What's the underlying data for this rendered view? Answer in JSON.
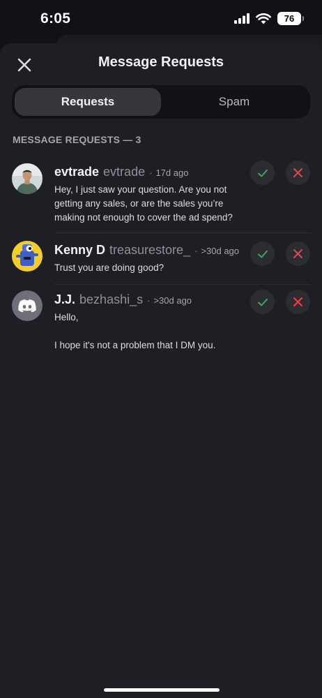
{
  "status_bar": {
    "time": "6:05",
    "battery": "76",
    "icons": [
      "signal-icon",
      "wifi-icon",
      "battery-icon"
    ]
  },
  "header": {
    "title": "Message Requests",
    "close_icon": "close-icon"
  },
  "tabs": [
    {
      "label": "Requests",
      "active": true
    },
    {
      "label": "Spam",
      "active": false
    }
  ],
  "section": {
    "title": "MESSAGE REQUESTS — 3"
  },
  "requests": [
    {
      "display_name": "evtrade",
      "username": "evtrade",
      "separator": "·",
      "timestamp": "17d ago",
      "message": "Hey, I just saw your question. Are you not getting any sales, or are the sales you’re making not enough to cover the ad spend?",
      "avatar": "user-photo-avatar"
    },
    {
      "display_name": "Kenny D",
      "username": "treasurestore_",
      "separator": "·",
      "timestamp": ">30d ago",
      "message": "Trust you are doing good?",
      "avatar": "cartoon-avatar"
    },
    {
      "display_name": "J.J.",
      "username": "bezhashi_s",
      "separator": "·",
      "timestamp": ">30d ago",
      "message": "Hello,\n\nI hope it's not a problem that I DM you.",
      "avatar": "discord-logo-avatar"
    }
  ],
  "actions": {
    "accept_icon": "check-icon",
    "decline_icon": "x-icon"
  },
  "colors": {
    "accept": "#3ba55d",
    "decline": "#ed4245",
    "sheet_bg": "#1e1f24",
    "app_bg": "#111216",
    "discord_blurple": "#5865f2"
  }
}
